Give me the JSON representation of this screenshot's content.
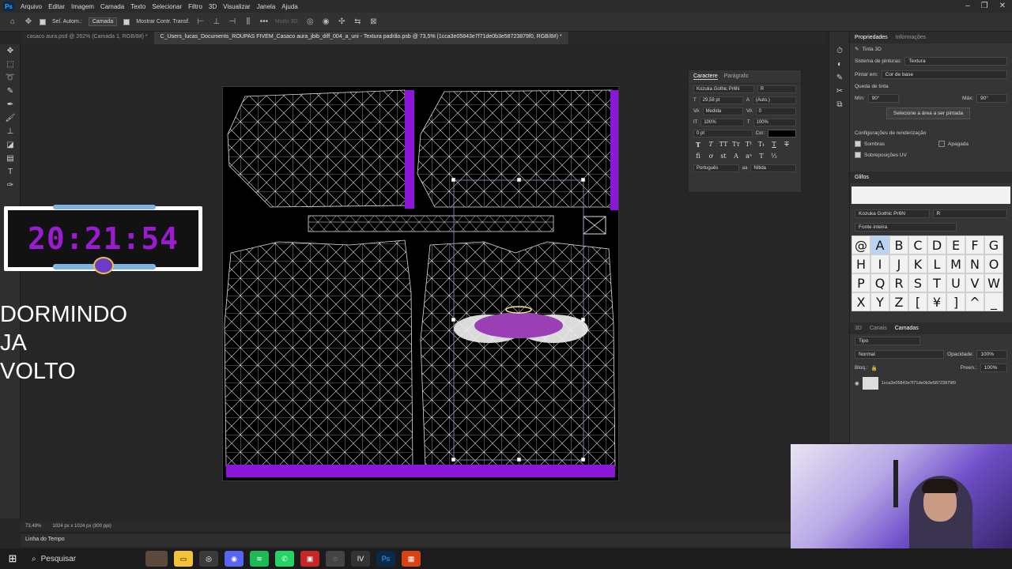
{
  "menubar": {
    "items": [
      "Arquivo",
      "Editar",
      "Imagem",
      "Camada",
      "Texto",
      "Selecionar",
      "Filtro",
      "3D",
      "Visualizar",
      "Janela",
      "Ajuda"
    ]
  },
  "options": {
    "auto_select_label": "Sel. Autom.:",
    "auto_select_value": "Camada",
    "show_transform_label": "Mostrar Contr. Transf.",
    "mode_3d_label": "Modo 3D:"
  },
  "tabs": [
    {
      "label": "casaco aura.psd @ 262% (Camada 1, RGB/8#) *"
    },
    {
      "label": "C_Users_lucas_Documents_ROUPAS FIVEM_Casaco aura_jbib_diff_004_a_uni - Textura padrão.psb @ 73,5% (1cca3e05843e7f71de0b3e58723879f0, RGB/8#) *"
    }
  ],
  "overlay": {
    "clock_time": "20:21:54",
    "away_line1": "DORMINDO",
    "away_line2": "JA",
    "away_line3": "VOLTO"
  },
  "status": {
    "zoom": "73,49%",
    "doc_size": "1024 px x 1024 px (300 ppi)",
    "timeline": "Linha do Tempo"
  },
  "character": {
    "tab_character": "Caractere",
    "tab_paragraph": "Parágrafo",
    "font": "Kozuka Gothic Pr6N",
    "style": "R",
    "size": "29,58 pt",
    "leading": "(Auto.)",
    "kerning": "Medida",
    "tracking": "0",
    "vscale": "100%",
    "hscale": "100%",
    "baseline": "0 pt",
    "color_label": "Cor:",
    "language": "Português",
    "antialias": "Nítida"
  },
  "properties": {
    "tab_properties": "Propriedades",
    "tab_info": "Informações",
    "section": "Tinta 3D",
    "paint_system_label": "Sistema de pinturas:",
    "paint_system_value": "Textura",
    "paint_on_label": "Pintar em:",
    "paint_on_value": "Cor de base",
    "falloff_label": "Queda de tinta",
    "min_label": "Mín:",
    "min_value": "90°",
    "max_label": "Máx:",
    "max_value": "90°",
    "select_area_button": "Selecione a área a ser pintada",
    "render_settings_label": "Configurações de renderização",
    "shadows_label": "Sombras",
    "faded_label": "Apagada",
    "uv_overlays_label": "Sobreposições UV"
  },
  "glyphs": {
    "title": "Glifos",
    "font": "Kozuka Gothic Pr6N",
    "style": "R",
    "subset": "Fonte inteira",
    "cells": [
      "@",
      "A",
      "B",
      "C",
      "D",
      "E",
      "F",
      "G",
      "H",
      "I",
      "J",
      "K",
      "L",
      "M",
      "N",
      "O",
      "P",
      "Q",
      "R",
      "S",
      "T",
      "U",
      "V",
      "W",
      "X",
      "Y",
      "Z",
      "[",
      "¥",
      "]",
      "^",
      "_"
    ]
  },
  "layers": {
    "tab_3d": "3D",
    "tab_channels": "Canais",
    "tab_layers": "Camadas",
    "filter_kind": "Tipo",
    "blend_mode": "Normal",
    "opacity_label": "Opacidade:",
    "opacity_value": "100%",
    "lock_label": "Bloq.:",
    "fill_label": "Preen.:",
    "fill_value": "100%",
    "layer_name": "1cca3e05843e7f71de0b3e58723879f0"
  },
  "taskbar": {
    "search_placeholder": "Pesquisar"
  },
  "colors": {
    "accent_purple": "#9a1bd1",
    "uv_purple": "#8a16d8",
    "clock_bar": "#7fb2df"
  }
}
